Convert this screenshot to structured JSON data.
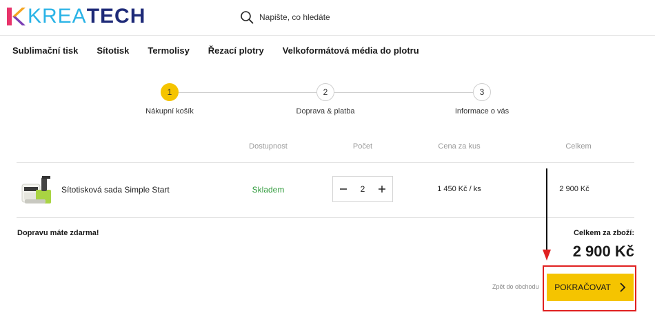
{
  "header": {
    "logo_krea": "KREA",
    "logo_tech": "TECH",
    "search_placeholder": "Napište, co hledáte"
  },
  "nav": {
    "items": [
      {
        "label": "Sublimační tisk"
      },
      {
        "label": "Sítotisk"
      },
      {
        "label": "Termolisy"
      },
      {
        "label": "Řezací plotry"
      },
      {
        "label": "Velkoformátová média do plotru"
      }
    ]
  },
  "steps": [
    {
      "number": "1",
      "label": "Nákupní košík",
      "active": true
    },
    {
      "number": "2",
      "label": "Doprava & platba",
      "active": false
    },
    {
      "number": "3",
      "label": "Informace o vás",
      "active": false
    }
  ],
  "cart": {
    "columns": [
      "Dostupnost",
      "Počet",
      "Cena za kus",
      "Celkem"
    ],
    "items": [
      {
        "name": "Sítotisková sada Simple Start",
        "availability": "Skladem",
        "quantity": "2",
        "unit_price": "1 450 Kč / ks",
        "total": "2 900 Kč"
      }
    ]
  },
  "summary": {
    "shipping_note": "Dopravu máte zdarma!",
    "total_label": "Celkem za zboží:",
    "total_value": "2 900 Kč"
  },
  "actions": {
    "back_label": "Zpět do obchodu",
    "continue_label": "POKRAČOVAT"
  },
  "colors": {
    "accent": "#f5c400",
    "stock_green": "#2e9a3a",
    "highlight_red": "#e02020",
    "logo_blue": "#2ab3e6",
    "logo_navy": "#1e2a78"
  },
  "icons": {
    "search": "search-icon",
    "minus": "minus-icon",
    "plus": "plus-icon",
    "chevron": "chevron-right-icon"
  }
}
